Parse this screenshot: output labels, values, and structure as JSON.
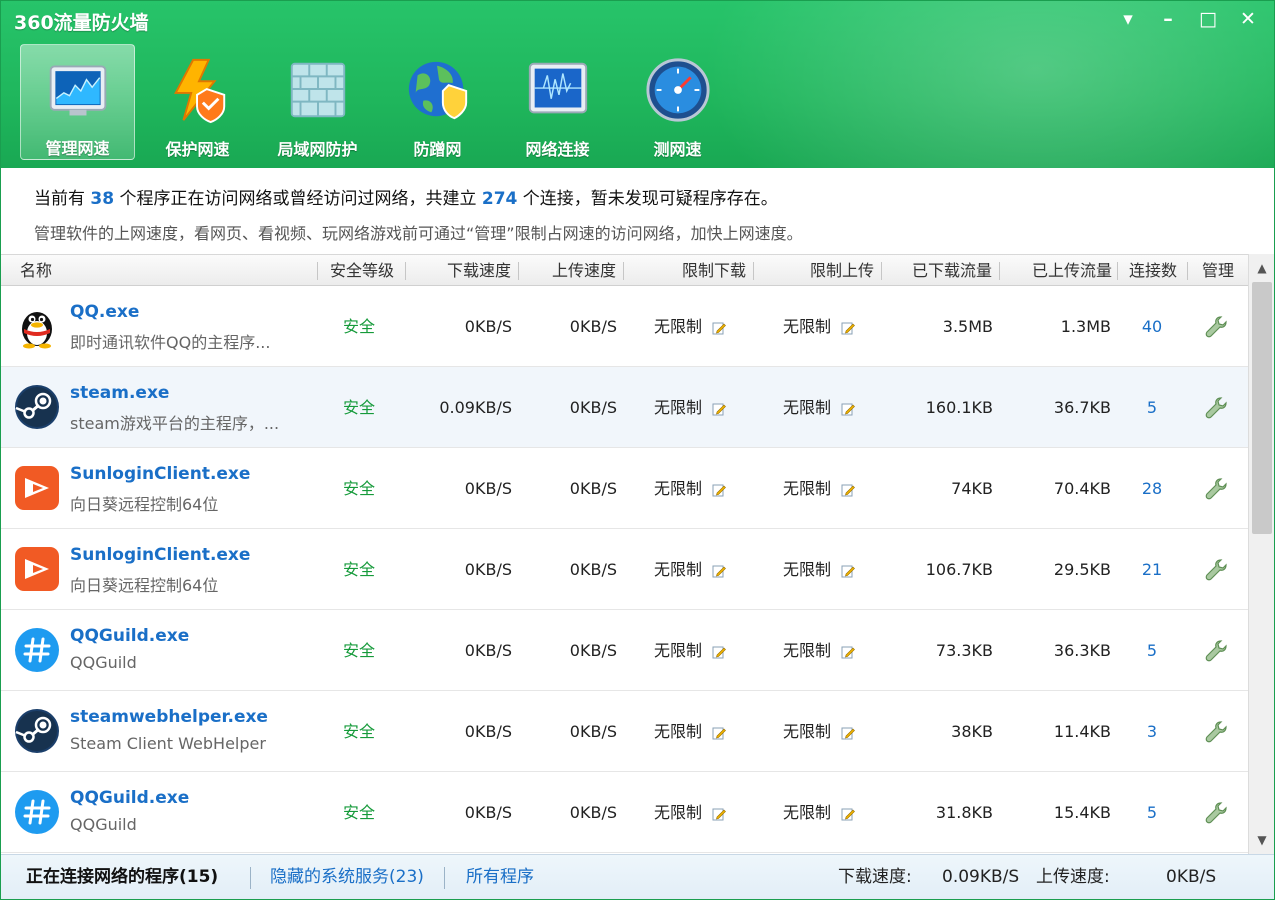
{
  "window": {
    "title": "360流量防火墙",
    "controls": {
      "menu": "▾",
      "minimize": "–",
      "maximize": "□",
      "close": "✕"
    }
  },
  "nav": [
    {
      "label": "管理网速",
      "icon": "speed-monitor-icon",
      "active": true
    },
    {
      "label": "保护网速",
      "icon": "lightning-shield-icon",
      "active": false
    },
    {
      "label": "局域网防护",
      "icon": "firewall-brick-icon",
      "active": false
    },
    {
      "label": "防蹭网",
      "icon": "globe-shield-icon",
      "active": false
    },
    {
      "label": "网络连接",
      "icon": "network-connection-icon",
      "active": false
    },
    {
      "label": "测网速",
      "icon": "speedometer-icon",
      "active": false
    }
  ],
  "info": {
    "prefix": "当前有 ",
    "program_count": "38",
    "mid": " 个程序正在访问网络或曾经访问过网络，共建立 ",
    "connection_count": "274",
    "suffix": " 个连接，暂未发现可疑程序存在。",
    "hint": "管理软件的上网速度，看网页、看视频、玩网络游戏前可通过“管理”限制占网速的访问网络，加快上网速度。"
  },
  "columns": {
    "name": "名称",
    "security": "安全等级",
    "download_speed": "下载速度",
    "upload_speed": "上传速度",
    "limit_download": "限制下载",
    "limit_upload": "限制上传",
    "downloaded": "已下载流量",
    "uploaded": "已上传流量",
    "connections": "连接数",
    "manage": "管理"
  },
  "rows": [
    {
      "name": "QQ.exe",
      "desc": "即时通讯软件QQ的主程序...",
      "icon": "qq-penguin-icon",
      "security": "安全",
      "down": "0KB/S",
      "up": "0KB/S",
      "limit_down": "无限制",
      "limit_up": "无限制",
      "downloaded": "3.5MB",
      "uploaded": "1.3MB",
      "connections": "40"
    },
    {
      "name": "steam.exe",
      "desc": "steam游戏平台的主程序，...",
      "icon": "steam-icon",
      "security": "安全",
      "down": "0.09KB/S",
      "up": "0KB/S",
      "limit_down": "无限制",
      "limit_up": "无限制",
      "downloaded": "160.1KB",
      "uploaded": "36.7KB",
      "connections": "5"
    },
    {
      "name": "SunloginClient.exe",
      "desc": "向日葵远程控制64位",
      "icon": "sunlogin-icon",
      "security": "安全",
      "down": "0KB/S",
      "up": "0KB/S",
      "limit_down": "无限制",
      "limit_up": "无限制",
      "downloaded": "74KB",
      "uploaded": "70.4KB",
      "connections": "28"
    },
    {
      "name": "SunloginClient.exe",
      "desc": "向日葵远程控制64位",
      "icon": "sunlogin-icon",
      "security": "安全",
      "down": "0KB/S",
      "up": "0KB/S",
      "limit_down": "无限制",
      "limit_up": "无限制",
      "downloaded": "106.7KB",
      "uploaded": "29.5KB",
      "connections": "21"
    },
    {
      "name": "QQGuild.exe",
      "desc": "QQGuild",
      "icon": "qqguild-icon",
      "security": "安全",
      "down": "0KB/S",
      "up": "0KB/S",
      "limit_down": "无限制",
      "limit_up": "无限制",
      "downloaded": "73.3KB",
      "uploaded": "36.3KB",
      "connections": "5"
    },
    {
      "name": "steamwebhelper.exe",
      "desc": "Steam Client WebHelper",
      "icon": "steam-icon",
      "security": "安全",
      "down": "0KB/S",
      "up": "0KB/S",
      "limit_down": "无限制",
      "limit_up": "无限制",
      "downloaded": "38KB",
      "uploaded": "11.4KB",
      "connections": "3"
    },
    {
      "name": "QQGuild.exe",
      "desc": "QQGuild",
      "icon": "qqguild-icon",
      "security": "安全",
      "down": "0KB/S",
      "up": "0KB/S",
      "limit_down": "无限制",
      "limit_up": "无限制",
      "downloaded": "31.8KB",
      "uploaded": "15.4KB",
      "connections": "5"
    }
  ],
  "status": {
    "tab_connected": "正在连接网络的程序(15)",
    "tab_hidden": "隐藏的系统服务(23)",
    "tab_all": "所有程序",
    "download_label": "下载速度:",
    "download_value": "0.09KB/S",
    "upload_label": "上传速度:",
    "upload_value": "0KB/S"
  },
  "colors": {
    "brand_green": "#1fb65c",
    "link_blue": "#1a6fc7",
    "safe_green": "#159a3a"
  }
}
